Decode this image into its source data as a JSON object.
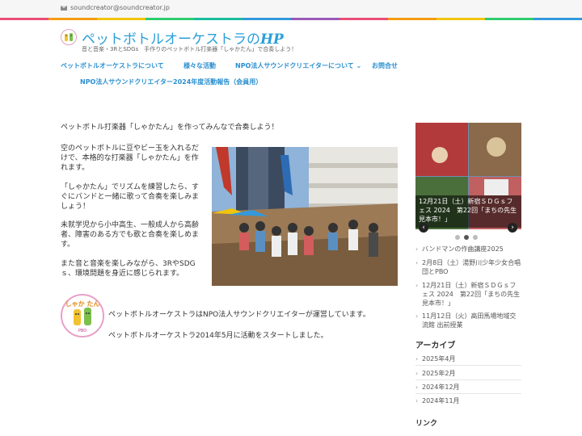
{
  "topbar": {
    "email": "soundcreator@soundcreator.jp",
    "icon": "envelope-icon"
  },
  "rainbow_colors": [
    "#e94e77",
    "#f39c12",
    "#f1c40f",
    "#2ecc71",
    "#1abc9c",
    "#3498db",
    "#9b59b6",
    "#e94e77",
    "#f39c12",
    "#f1c40f",
    "#2ecc71",
    "#3498db"
  ],
  "header": {
    "title_main": "ペットボトルオーケストラの",
    "title_hp": "HP",
    "tagline": "音と音楽・3RとSDGs　手作りのペットボトル打楽器「しゃかたん」で合奏しよう！"
  },
  "nav": {
    "items": [
      {
        "label": "ペットボトルオーケストラについて"
      },
      {
        "label": "様々な活動"
      },
      {
        "label": "NPO法人サウンドクリエイターについて ⌄"
      },
      {
        "label": "お問合せ"
      },
      {
        "label": "NPO法人サウンドクリエイター2024年度活動報告（会員用）"
      }
    ]
  },
  "main": {
    "lead": "ペットボトル打楽器「しゃかたん」を作ってみんなで合奏しよう！",
    "para1": "空のペットボトルに豆やビー玉を入れるだけで、本格的な打楽器「しゃかたん」を作れます。",
    "para2": "「しゃかたん」でリズムを練習したら、すぐにバンドと一緒に歌って合奏を楽しみましょう！",
    "para3": "未就学児から小中高生、一般成人から高齢者、障害のある方でも歌と合奏を楽しめます。",
    "para4": "また音と音楽を楽しみながら、3RやSDGｓ、環境問題を身近に感じられます。",
    "badge_text": "しゃか たん",
    "badge_sub": "PBO",
    "npo_line": "ペットボトルオーケストラはNPO法人サウンドクリエイターが運営しています。",
    "start_line": "ペットボトルオーケストラ2014年5月に活動をスタートしました。"
  },
  "sidebar": {
    "slider_caption": "12月21日（土）新宿ＳＤＧｓフェス 2024　第22回「まちの先生見本市！」",
    "prev": "‹",
    "next": "›",
    "recent_posts": [
      {
        "label": "バンドマンの作曲講座2025"
      },
      {
        "label": "2月8日（土）湯野川少年少女合唱団とPBO"
      },
      {
        "label": "12月21日（土）新宿ＳＤＧｓフェス 2024　第22回「まちの先生見本市！」"
      },
      {
        "label": "11月12日（火）高田馬場地域交流館 出前授業"
      }
    ],
    "archive_heading": "アーカイブ",
    "archives": [
      {
        "label": "2025年4月"
      },
      {
        "label": "2025年2月"
      },
      {
        "label": "2024年12月"
      },
      {
        "label": "2024年11月"
      }
    ],
    "links_heading": "リンク"
  }
}
